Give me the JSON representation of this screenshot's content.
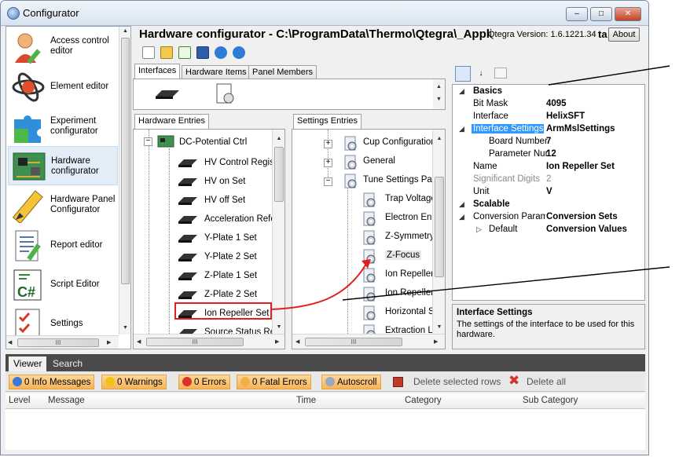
{
  "window": {
    "title": "Configurator",
    "controls": {
      "minimize": "–",
      "maximize": "□",
      "close": "✕"
    }
  },
  "nav": {
    "items": [
      {
        "label": "Access control editor",
        "icon": "user-pencil-icon"
      },
      {
        "label": "Element editor",
        "icon": "atom-icon"
      },
      {
        "label": "Experiment configurator",
        "icon": "puzzle-icon"
      },
      {
        "label": "Hardware configurator",
        "icon": "circuit-board-icon"
      },
      {
        "label": "Hardware Panel Configurator",
        "icon": "pencil-icon"
      },
      {
        "label": "Report editor",
        "icon": "report-icon"
      },
      {
        "label": "Script Editor",
        "icon": "csharp-icon"
      },
      {
        "label": "Settings",
        "icon": "checklist-icon"
      }
    ],
    "hscroll_mark": "III"
  },
  "header": {
    "title": "Hardware configurator - C:\\ProgramData\\Thermo\\Qtegra\\_Applic",
    "version": "Qtegra Version: 1.6.1221.34",
    "trailing": "ta",
    "about": "About"
  },
  "iface_tabs": [
    "Interfaces",
    "Hardware Items",
    "Panel Members"
  ],
  "hardware": {
    "tab": "Hardware Entries",
    "root": "DC-Potential Ctrl",
    "items": [
      "HV Control Regis",
      "HV on Set",
      "HV off Set",
      "Acceleration Refe",
      "Y-Plate 1 Set",
      "Y-Plate 2 Set",
      "Z-Plate 1 Set",
      "Z-Plate 2 Set",
      "Ion Repeller Set",
      "Source Status Re"
    ],
    "hscroll_mark": "III"
  },
  "settings": {
    "tab": "Settings Entries",
    "groups": [
      "Cup Configuration",
      "General",
      "Tune Settings Par"
    ],
    "items": [
      "Trap Voltage",
      "Electron Ene",
      "Z-Symmetry",
      "Z-Focus",
      "Ion Repeller",
      "Ion Repeller",
      "Horizontal S",
      "Extraction L"
    ],
    "hscroll_mark": "III"
  },
  "properties": {
    "rows": [
      {
        "type": "cat",
        "name": "Basics"
      },
      {
        "type": "prop",
        "name": "Bit Mask",
        "value": "4095"
      },
      {
        "type": "prop",
        "name": "Interface",
        "value": "HelixSFT"
      },
      {
        "type": "sub",
        "name": "Interface Settings",
        "value": "ArmMslSettings",
        "selected": true
      },
      {
        "type": "child",
        "name": "Board Number",
        "value": "7"
      },
      {
        "type": "child",
        "name": "Parameter Nur",
        "value": "12"
      },
      {
        "type": "prop",
        "name": "Name",
        "value": "Ion Repeller Set"
      },
      {
        "type": "prop",
        "name": "Significant Digits",
        "value": "2",
        "gray": true
      },
      {
        "type": "prop",
        "name": "Unit",
        "value": "V"
      },
      {
        "type": "cat",
        "name": "Scalable"
      },
      {
        "type": "sub",
        "name": "Conversion Parame",
        "value": "Conversion Sets"
      },
      {
        "type": "child2",
        "name": "Default",
        "value": "Conversion Values"
      }
    ],
    "description_title": "Interface Settings",
    "description_text": "The settings of the interface to be used for this hardware."
  },
  "log": {
    "tabs": [
      "Viewer",
      "Search"
    ],
    "filters": [
      {
        "label": "0 Info Messages",
        "color": "#3a78d8"
      },
      {
        "label": "0 Warnings",
        "color": "#f1c40f"
      },
      {
        "label": "0 Errors",
        "color": "#d9332a"
      },
      {
        "label": "0 Fatal Errors",
        "color": "#f0b048"
      },
      {
        "label": "Autoscroll",
        "color": "#9aa8c0"
      }
    ],
    "actions": {
      "delete_selected": "Delete selected rows",
      "delete_all": "Delete all"
    },
    "columns": [
      "Level",
      "Message",
      "Time",
      "Category",
      "Sub Category"
    ]
  },
  "colors": {
    "highlight": "#e02020",
    "selection": "#3399ff",
    "accent": "#f6b35a"
  }
}
